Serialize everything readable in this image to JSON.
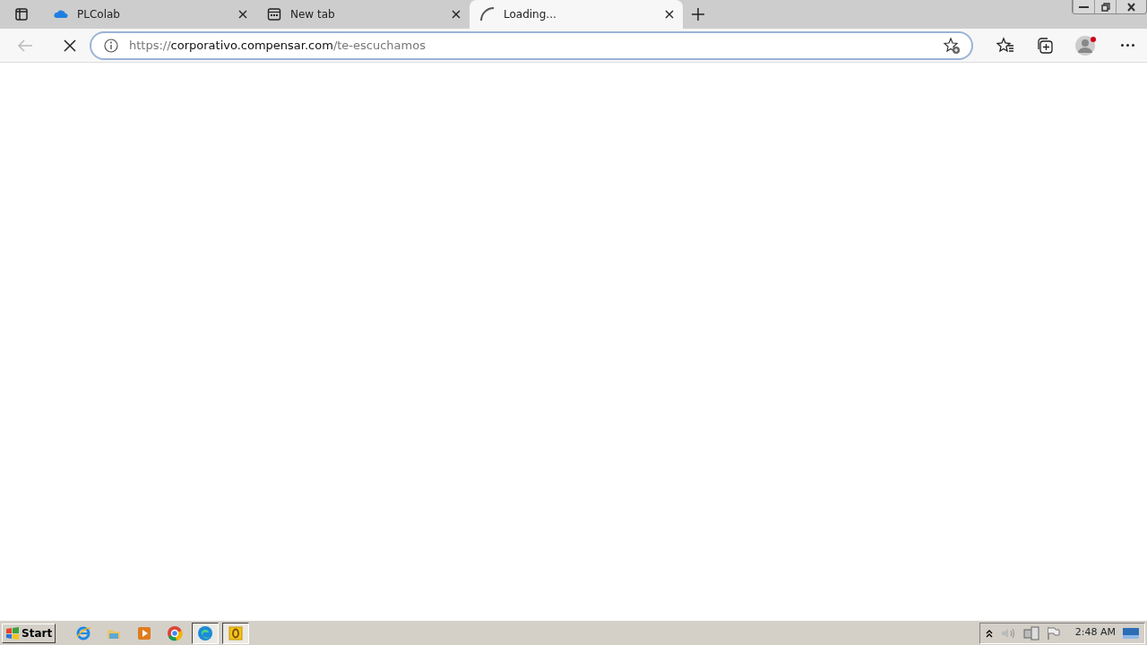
{
  "tabs": [
    {
      "title": "PLColab",
      "kind": "cloud",
      "selected": false
    },
    {
      "title": "New tab",
      "kind": "newtab",
      "selected": false
    },
    {
      "title": "Loading...",
      "kind": "spinner",
      "selected": true
    }
  ],
  "address": {
    "scheme": "https://",
    "host": "corporativo.compensar.com",
    "path": "/te-escuchamos"
  },
  "taskbar": {
    "start": "Start",
    "apps": [
      {
        "kind": "ie",
        "pressed": false
      },
      {
        "kind": "folder",
        "pressed": false
      },
      {
        "kind": "media",
        "pressed": false
      },
      {
        "kind": "chrome",
        "pressed": false
      },
      {
        "kind": "edge",
        "pressed": true
      },
      {
        "kind": "outlook",
        "pressed": true
      }
    ],
    "clock": "2:48 AM"
  }
}
